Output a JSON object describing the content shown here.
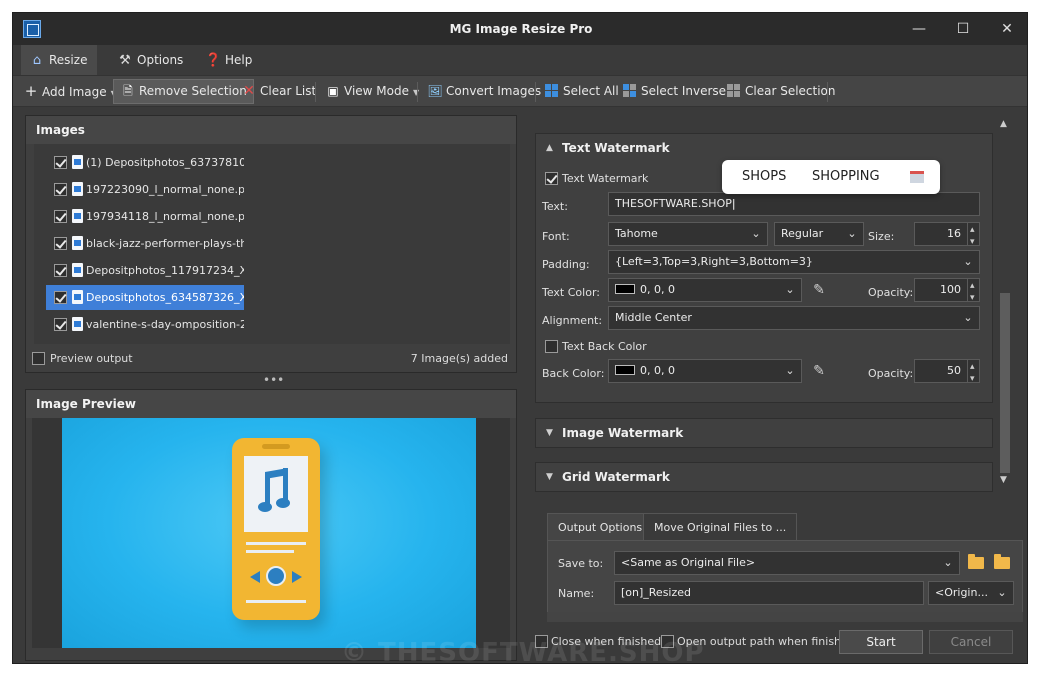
{
  "window": {
    "title": "MG Image Resize Pro"
  },
  "tabs": [
    {
      "label": "Resize",
      "icon": "house-icon"
    },
    {
      "label": "Options",
      "icon": "tools-icon"
    },
    {
      "label": "Help",
      "icon": "help-icon"
    }
  ],
  "toolbar": {
    "add_image": "Add Image",
    "remove_selection": "Remove Selection",
    "clear_list": "Clear List",
    "view_mode": "View Mode",
    "convert_images": "Convert Images",
    "select_all": "Select All",
    "select_inverse": "Select Inverse",
    "clear_selection": "Clear Selection"
  },
  "images_panel": {
    "title": "Images",
    "files": [
      {
        "name": "(1) Depositphotos_63737810...",
        "checked": true
      },
      {
        "name": "197223090_l_normal_none.png",
        "checked": true
      },
      {
        "name": "197934118_l_normal_none.png",
        "checked": true
      },
      {
        "name": "black-jazz-performer-plays-th...",
        "checked": true
      },
      {
        "name": "Depositphotos_117917234_X...",
        "checked": true
      },
      {
        "name": "Depositphotos_634587326_X...",
        "checked": true,
        "selected": true
      },
      {
        "name": "valentine-s-day-omposition-2...",
        "checked": true
      }
    ],
    "preview_output": "Preview output",
    "count": "7 Image(s) added"
  },
  "preview_panel": {
    "title": "Image Preview"
  },
  "text_watermark": {
    "title": "Text Watermark",
    "enable_label": "Text Watermark",
    "text_label": "Text:",
    "text_value": "THESOFTWARE.SHOP",
    "font_label": "Font:",
    "font_value": "Tahome",
    "style_value": "Regular",
    "size_label": "Size:",
    "size_value": "16",
    "padding_label": "Padding:",
    "padding_value": "{Left=3,Top=3,Right=3,Bottom=3}",
    "text_color_label": "Text Color:",
    "text_color_value": "0, 0, 0",
    "opacity_label": "Opacity:",
    "opacity_value": "100",
    "alignment_label": "Alignment:",
    "alignment_value": "Middle Center",
    "back_color_enable": "Text Back Color",
    "back_color_label": "Back Color:",
    "back_color_value": "0, 0, 0",
    "back_opacity_label": "Opacity:",
    "back_opacity_value": "50"
  },
  "image_watermark": {
    "title": "Image Watermark"
  },
  "grid_watermark": {
    "title": "Grid Watermark"
  },
  "popup": {
    "items": [
      "SHOPS",
      "SHOPPING"
    ]
  },
  "output": {
    "tabs": [
      "Output Options",
      "Move Original Files to ..."
    ],
    "save_to_label": "Save to:",
    "save_to_value": "<Same as Original File>",
    "name_label": "Name:",
    "name_value": "[on]_Resized",
    "name_option": "<Origin..."
  },
  "footer": {
    "close_when_finished": "Close when finished",
    "open_output_path": "Open output path when finished",
    "start": "Start",
    "cancel": "Cancel"
  },
  "watermark_overlay": "© THESOFTWARE.SHOP",
  "colors": {
    "accent": "#3f7fd8",
    "background": "#3a3a3a",
    "photo_bg": "#26b4ee",
    "phone": "#f2b632"
  }
}
